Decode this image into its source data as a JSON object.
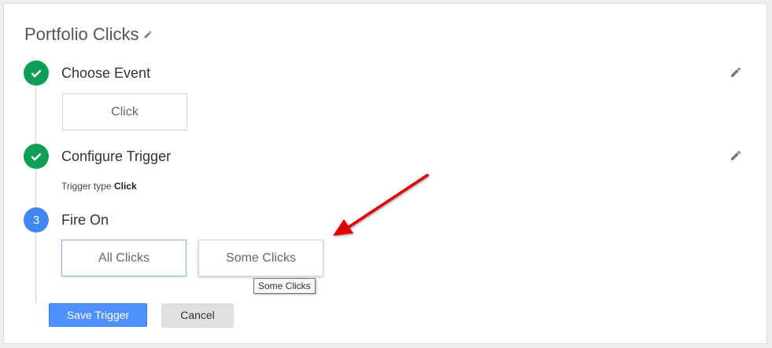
{
  "page": {
    "title": "Portfolio Clicks"
  },
  "steps": [
    {
      "title": "Choose Event",
      "state": "done",
      "icon": "check-icon"
    },
    {
      "title": "Configure Trigger",
      "state": "done",
      "icon": "check-icon"
    },
    {
      "number": "3",
      "title": "Fire On",
      "state": "active"
    }
  ],
  "event": {
    "selected": "Click"
  },
  "trigger": {
    "type_label": "Trigger type",
    "type_value": "Click"
  },
  "fire_on": {
    "options": [
      "All Clicks",
      "Some Clicks"
    ],
    "selected": "All Clicks",
    "tooltip": "Some Clicks"
  },
  "actions": {
    "save_label": "Save Trigger",
    "cancel_label": "Cancel"
  },
  "colors": {
    "success": "#0f9d58",
    "step_active": "#4285f4",
    "primary_button": "#4d90fe",
    "annotation_arrow": "#e00000"
  }
}
